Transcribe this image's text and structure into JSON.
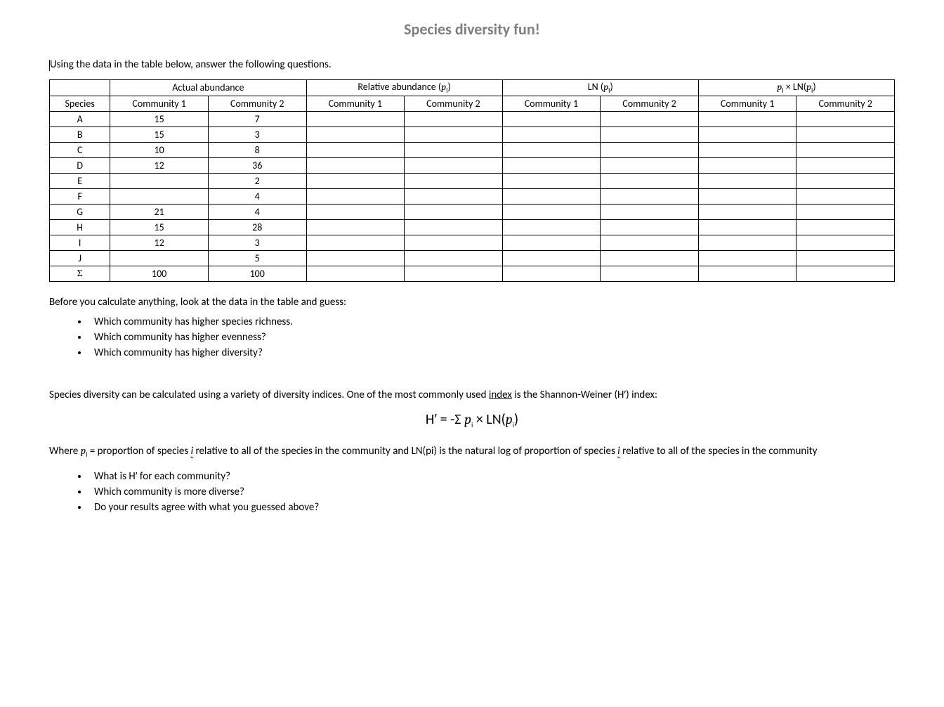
{
  "title": "Species diversity fun!",
  "intro": "Using the data in the table below, answer the following questions.",
  "table": {
    "groupHeaders": {
      "blank": "",
      "actual": "Actual abundance",
      "relative_prefix": "Relative abundance (",
      "relative_p": "p",
      "relative_i": "i",
      "relative_suffix": ")",
      "ln_prefix": "LN (",
      "ln_p": "p",
      "ln_i": "i",
      "ln_suffix": ")",
      "plnp_p1": "p",
      "plnp_i1": "i",
      "plnp_mid": " × LN(",
      "plnp_p2": "p",
      "plnp_i2": "i",
      "plnp_suffix": ")"
    },
    "colHeaders": {
      "species": "Species",
      "c1": "Community 1",
      "c2": "Community 2"
    },
    "rows": [
      {
        "species": "A",
        "c1": "15",
        "c2": "7"
      },
      {
        "species": "B",
        "c1": "15",
        "c2": "3"
      },
      {
        "species": "C",
        "c1": "10",
        "c2": "8"
      },
      {
        "species": "D",
        "c1": "12",
        "c2": "36"
      },
      {
        "species": "E",
        "c1": "",
        "c2": "2"
      },
      {
        "species": "F",
        "c1": "",
        "c2": "4"
      },
      {
        "species": "G",
        "c1": "21",
        "c2": "4"
      },
      {
        "species": "H",
        "c1": "15",
        "c2": "28"
      },
      {
        "species": "I",
        "c1": "12",
        "c2": "3"
      },
      {
        "species": "J",
        "c1": "",
        "c2": "5"
      },
      {
        "species": "Σ",
        "c1": "100",
        "c2": "100"
      }
    ]
  },
  "beforeCalc": "Before you calculate anything, look at the data in the table and guess:",
  "bullets1": [
    "Which community has higher species richness.",
    "Which community has higher evenness?",
    "Which community has higher diversity?"
  ],
  "diversityPara": {
    "part1": "Species diversity can be calculated using a variety of diversity indices.  One of the most commonly used ",
    "indexWord": "index",
    "part2": " is the Shannon-Weiner (H′) index:"
  },
  "formula": {
    "h": "H′ = -Σ ",
    "p1": "p",
    "i1": "i",
    "mid": " × LN(",
    "p2": "p",
    "i2": "i",
    "end": ")"
  },
  "wherePara": {
    "t1": "Where ",
    "p1": "p",
    "i1": "i",
    "t2": " = proportion of species ",
    "iWord1": "i",
    "t3": " relative to all of the species in the community and LN(pi) is the natural log of proportion of species ",
    "iWord2": "i",
    "t4": " relative to all of the species in the community"
  },
  "bullets2": [
    "What is H′ for each community?",
    "Which community is more diverse?",
    "Do your results agree with what you guessed above?"
  ]
}
